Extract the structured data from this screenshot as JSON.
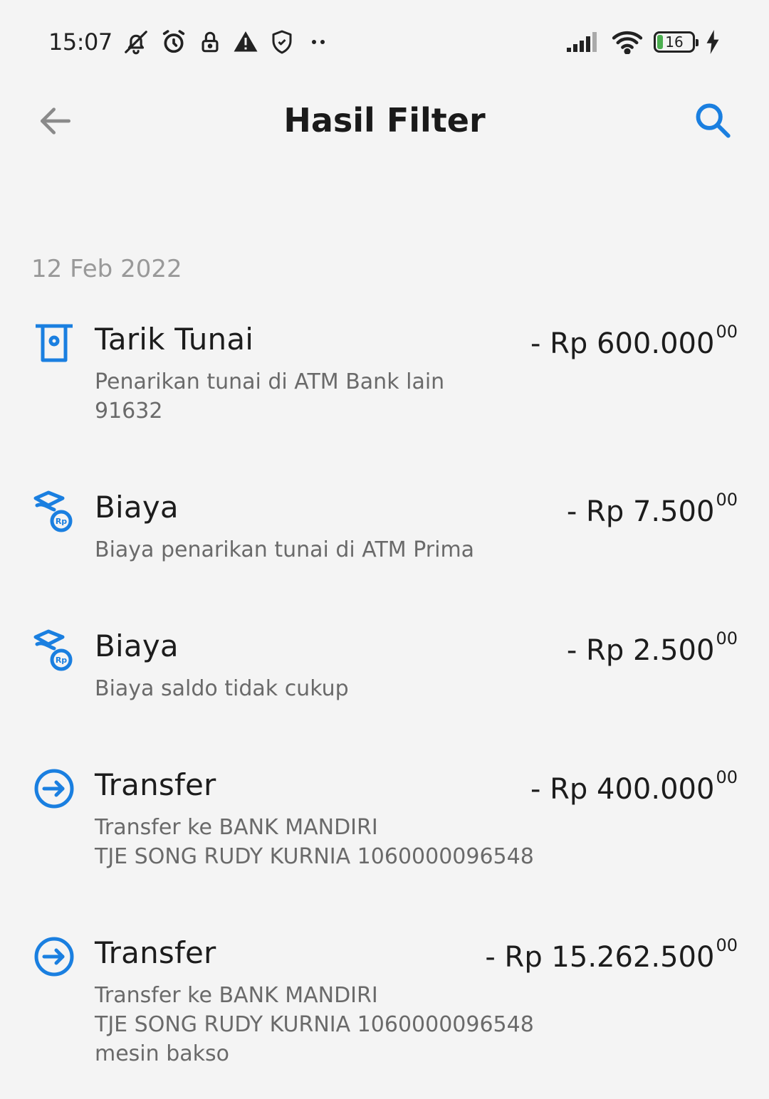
{
  "status_bar": {
    "time": "15:07",
    "icons_left": [
      "bell-off-icon",
      "alarm-icon",
      "lock-icon",
      "warning-icon",
      "shield-icon",
      "more-dots-icon"
    ],
    "icons_right": [
      "signal-icon",
      "wifi-icon",
      "battery-icon",
      "charging-icon"
    ],
    "battery_level": "16",
    "battery_fraction": 0.16
  },
  "header": {
    "title": "Hasil Filter",
    "back_icon": "arrow-left-icon",
    "search_icon": "search-icon"
  },
  "colors": {
    "accent": "#1a7fe0",
    "background": "#f4f4f4",
    "text": "#1c1c1c",
    "subtext": "#6a6a6a",
    "date": "#999999"
  },
  "date_group": "12 Feb 2022",
  "transactions": [
    {
      "icon": "atm-withdrawal-icon",
      "title": "Tarik Tunai",
      "amount": "- Rp 600.000",
      "cents": "00",
      "desc1": "Penarikan tunai di ATM Bank lain",
      "desc2": "91632",
      "desc3": ""
    },
    {
      "icon": "fee-icon",
      "title": "Biaya",
      "amount": "- Rp 7.500",
      "cents": "00",
      "desc1": "Biaya penarikan tunai di ATM Prima",
      "desc2": "",
      "desc3": ""
    },
    {
      "icon": "fee-icon",
      "title": "Biaya",
      "amount": "- Rp 2.500",
      "cents": "00",
      "desc1": "Biaya saldo tidak cukup",
      "desc2": "",
      "desc3": ""
    },
    {
      "icon": "transfer-icon",
      "title": "Transfer",
      "amount": "- Rp 400.000",
      "cents": "00",
      "desc1": "Transfer ke BANK MANDIRI",
      "desc2": "TJE SONG RUDY KURNIA 1060000096548",
      "desc3": ""
    },
    {
      "icon": "transfer-icon",
      "title": "Transfer",
      "amount": "- Rp 15.262.500",
      "cents": "00",
      "desc1": "Transfer ke BANK MANDIRI",
      "desc2": "TJE SONG RUDY KURNIA 1060000096548",
      "desc3": "mesin bakso"
    }
  ]
}
